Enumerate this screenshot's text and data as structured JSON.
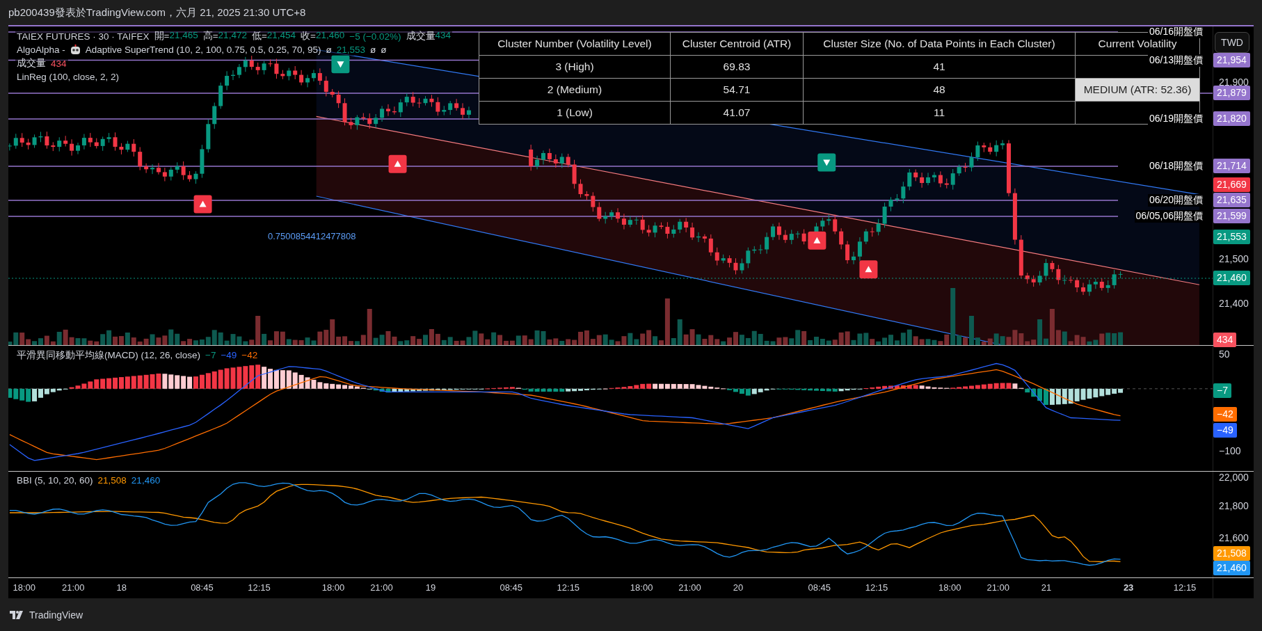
{
  "header": {
    "text": "pb200439發表於TradingView.com，六月 21, 2025 21:30 UTC+8"
  },
  "legend": {
    "symbol": "TAIEX FUTURES · 30 · TAIFEX",
    "ohlc": [
      {
        "label": "開=",
        "value": "21,465"
      },
      {
        "label": "高=",
        "value": "21,472"
      },
      {
        "label": "低=",
        "value": "21,454"
      },
      {
        "label": "收=",
        "value": "21,460"
      }
    ],
    "change": "−5 (−0.02%)",
    "volume_label": "成交量",
    "volume_value": "434"
  },
  "supertrend": {
    "prefix": "AlgoAlpha -",
    "title": "Adaptive SuperTrend (10, 2, 100, 0.75, 0.5, 0.25, 70, 95)",
    "values": [
      {
        "text": "ø",
        "color": "#d1d4dc"
      },
      {
        "text": "21,553",
        "color": "#089981"
      },
      {
        "text": "ø",
        "color": "#d1d4dc"
      },
      {
        "text": "ø",
        "color": "#d1d4dc"
      }
    ]
  },
  "volume": {
    "label": "成交量",
    "value": "434"
  },
  "linreg": {
    "label": "LinReg (100, close, 2, 2)"
  },
  "table": {
    "columns": [
      "Cluster Number (Volatility Level)",
      "Cluster Centroid (ATR)",
      "Cluster Size (No. of Data Points in Each Cluster)",
      "Current Volatility"
    ],
    "rows": [
      {
        "cells": [
          "3 (High)",
          "69.83",
          "41"
        ]
      },
      {
        "cells": [
          "2 (Medium)",
          "54.71",
          "48"
        ],
        "current": "MEDIUM (ATR: 52.36)"
      },
      {
        "cells": [
          "1 (Low)",
          "41.07",
          "11"
        ]
      }
    ]
  },
  "levels": [
    {
      "label": "06/16開盤價"
    },
    {
      "label": "06/13開盤價",
      "tag": "21,954"
    },
    {
      "tag": "21,879"
    },
    {
      "label": "06/19開盤價",
      "tag": "21,820"
    },
    {
      "label": "06/18開盤價",
      "tag": "21,714"
    },
    {
      "label": "06/20開盤價",
      "tag": "21,635"
    },
    {
      "label": "06/05,06開盤價",
      "tag": "21,599"
    }
  ],
  "fib_label": "0.7500854412477808",
  "price_axis": {
    "unit_button": "TWD",
    "ticks": [
      "21,900",
      "21,500",
      "21,400"
    ],
    "tags": [
      {
        "text": "21,669",
        "color": "#f23645"
      },
      {
        "text": "21,553",
        "color": "#089981"
      },
      {
        "text": "21,460",
        "color": "#089981"
      },
      {
        "text": "434",
        "color": "#f7525f"
      }
    ]
  },
  "macd": {
    "title": "平滑異同移動平均線(MACD) (12, 26, close)",
    "values": [
      {
        "text": "−7",
        "color": "#089981"
      },
      {
        "text": "−49",
        "color": "#2962ff"
      },
      {
        "text": "−42",
        "color": "#ff6d00"
      }
    ],
    "ticks": [
      "50",
      "−100"
    ],
    "tags": [
      {
        "text": "−7",
        "color": "#089981"
      },
      {
        "text": "−42",
        "color": "#ff6d00"
      },
      {
        "text": "−49",
        "color": "#2962ff"
      }
    ]
  },
  "bbi": {
    "title": "BBI (5, 10, 20, 60)",
    "values": [
      {
        "text": "21,508",
        "color": "#ff9800"
      },
      {
        "text": "21,460",
        "color": "#2196f3"
      }
    ],
    "ticks": [
      "22,000",
      "21,800",
      "21,600"
    ],
    "tags": [
      {
        "text": "21,508",
        "color": "#ff9800"
      },
      {
        "text": "21,460",
        "color": "#2196f3"
      }
    ]
  },
  "time_axis": {
    "labels": [
      {
        "text": "18:00",
        "bold": false
      },
      {
        "text": "21:00",
        "bold": false
      },
      {
        "text": "18",
        "bold": false
      },
      {
        "text": "08:45",
        "bold": false
      },
      {
        "text": "12:15",
        "bold": false
      },
      {
        "text": "18:00",
        "bold": false
      },
      {
        "text": "21:00",
        "bold": false
      },
      {
        "text": "19",
        "bold": false
      },
      {
        "text": "08:45",
        "bold": false
      },
      {
        "text": "12:15",
        "bold": false
      },
      {
        "text": "18:00",
        "bold": false
      },
      {
        "text": "21:00",
        "bold": false
      },
      {
        "text": "20",
        "bold": false
      },
      {
        "text": "08:45",
        "bold": false
      },
      {
        "text": "12:15",
        "bold": false
      },
      {
        "text": "18:00",
        "bold": false
      },
      {
        "text": "21:00",
        "bold": false
      },
      {
        "text": "21",
        "bold": false
      },
      {
        "text": "23",
        "bold": true
      },
      {
        "text": "12:15",
        "bold": false
      }
    ]
  },
  "footer": {
    "brand": "TradingView"
  }
}
